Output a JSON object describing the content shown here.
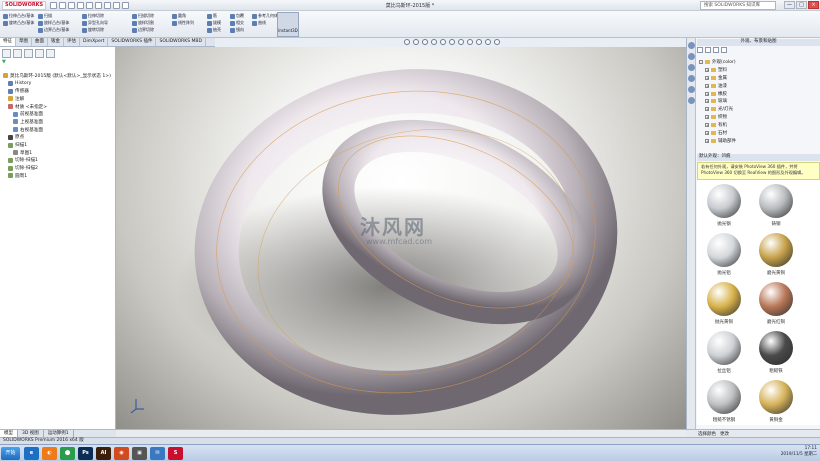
{
  "window": {
    "title": "莫比乌斯环-2015版 *",
    "search_placeholder": "搜索 SOLIDWORKS 知识库",
    "logo_brand": "SOLIDWORKS",
    "controls": [
      "—",
      "□",
      "×"
    ]
  },
  "ribbon": {
    "groups": [
      {
        "items": [
          "拉伸凸台/基体",
          "旋转凸台/基体"
        ]
      },
      {
        "items": [
          "扫描",
          "放样凸台/基体",
          "边界凸台/基体"
        ]
      },
      {
        "items": [
          "拉伸切除",
          "异型孔向导",
          "旋转切除"
        ]
      },
      {
        "items": [
          "扫描切除",
          "放样切割",
          "边界切除"
        ]
      },
      {
        "items": [
          "圆角",
          "线性阵列"
        ]
      },
      {
        "items": [
          "筋",
          "拔模",
          "抽壳"
        ]
      },
      {
        "items": [
          "包覆",
          "相交",
          "镜向"
        ]
      },
      {
        "items": [
          "参考几何体",
          "曲线"
        ]
      }
    ],
    "instant3d": "Instant3D"
  },
  "tabs": [
    "特征",
    "草图",
    "曲面",
    "钣金",
    "评估",
    "DimXpert",
    "SOLIDWORKS 插件",
    "SOLIDWORKS MBD"
  ],
  "feature_tree": {
    "filter_icon": "filter-icon",
    "nodes": [
      {
        "label": "莫比乌斯环-2015版 (默认<默认>_显示状态 1>)",
        "indent": 0,
        "color": "#e0a030"
      },
      {
        "label": "History",
        "indent": 1,
        "color": "#5f7fb0"
      },
      {
        "label": "传感器",
        "indent": 1,
        "color": "#5f7fb0"
      },
      {
        "label": "注解",
        "indent": 1,
        "color": "#d4a637"
      },
      {
        "label": "材质 <未指定>",
        "indent": 1,
        "color": "#c66"
      },
      {
        "label": "前视基准面",
        "indent": 2,
        "color": "#6b8cc0"
      },
      {
        "label": "上视基准面",
        "indent": 2,
        "color": "#6b8cc0"
      },
      {
        "label": "右视基准面",
        "indent": 2,
        "color": "#6b8cc0"
      },
      {
        "label": "原点",
        "indent": 1,
        "color": "#444"
      },
      {
        "label": "扫描1",
        "indent": 1,
        "color": "#7a9e5a"
      },
      {
        "label": "草图1",
        "indent": 2,
        "color": "#888"
      },
      {
        "label": "切除-扫描1",
        "indent": 1,
        "color": "#7a9e5a"
      },
      {
        "label": "切除-扫描2",
        "indent": 1,
        "color": "#7a9e5a"
      },
      {
        "label": "圆周1",
        "indent": 1,
        "color": "#7a9e5a"
      }
    ]
  },
  "viewport": {
    "watermark_cn": "沐风网",
    "watermark_url": "www.mfcad.com"
  },
  "appearances": {
    "title": "外观、布景和贴图",
    "tree": [
      {
        "label": "外观(color)",
        "expand": "-"
      },
      {
        "label": "塑料",
        "expand": "+"
      },
      {
        "label": "金属",
        "expand": "+"
      },
      {
        "label": "油漆",
        "expand": "+"
      },
      {
        "label": "橡胶",
        "expand": "+"
      },
      {
        "label": "玻璃",
        "expand": "+"
      },
      {
        "label": "光/灯光",
        "expand": "+"
      },
      {
        "label": "织物",
        "expand": "+"
      },
      {
        "label": "有机",
        "expand": "+"
      },
      {
        "label": "石材",
        "expand": "+"
      },
      {
        "label": "辅助部件",
        "expand": "+"
      }
    ],
    "section_header": "默认外观：凹痕",
    "tip": "若有任何外观，请安装 PhotoView 360 插件，并将 PhotoView 360 切换至 RealView 的图形及外观编辑。",
    "swatches": [
      {
        "label": "抛光钢",
        "color": "#c8ccd0"
      },
      {
        "label": "铸钢",
        "color": "#b9bcbf"
      },
      {
        "label": "抛光铝",
        "color": "#d4d7db"
      },
      {
        "label": "磨光黄铜",
        "color": "#c7a24a"
      },
      {
        "label": "抛光黄铜",
        "color": "#d8b24c"
      },
      {
        "label": "磨光红铜",
        "color": "#b97858"
      },
      {
        "label": "拉丝铝",
        "color": "#cfd2d5"
      },
      {
        "label": "粗糙铁",
        "color": "#4a4a4c"
      },
      {
        "label": "粗糙不锈钢",
        "color": "#bfc1c3"
      },
      {
        "label": "黄铜金",
        "color": "#d6b35a"
      }
    ],
    "footer": [
      "选择颜色",
      "更改"
    ]
  },
  "bottom_tabs": [
    "模型",
    "3D 视图",
    "运动算例1"
  ],
  "status_bar": "SOLIDWORKS Premium 2016 x64 版",
  "taskbar": {
    "start": "开始",
    "apps": [
      {
        "glyph": "e",
        "color": "#1e6fc4"
      },
      {
        "glyph": "◐",
        "color": "#ee7a1a"
      },
      {
        "glyph": "⬤",
        "color": "#2b9b4c"
      },
      {
        "glyph": "Ps",
        "color": "#0b2c55"
      },
      {
        "glyph": "AI",
        "color": "#3b1f0b"
      },
      {
        "glyph": "◉",
        "color": "#d24b1e"
      },
      {
        "glyph": "▣",
        "color": "#555"
      },
      {
        "glyph": "✉",
        "color": "#3a78c2"
      },
      {
        "glyph": "S",
        "color": "#c8102e"
      }
    ],
    "clock_time": "17:11",
    "clock_date": "2019/11/5 星期二"
  }
}
